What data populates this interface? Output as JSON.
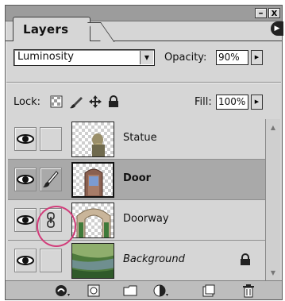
{
  "panel": {
    "tab_label": "Layers",
    "window_buttons": [
      "–",
      "x"
    ]
  },
  "blend_mode": {
    "selected": "Luminosity"
  },
  "opacity": {
    "label": "Opacity:",
    "value": "90%"
  },
  "lock": {
    "label": "Lock:",
    "icons": [
      "transparent-pixels-lock-icon",
      "brush-lock-icon",
      "move-lock-icon",
      "padlock-icon"
    ]
  },
  "fill": {
    "label": "Fill:",
    "value": "100%"
  },
  "layers": [
    {
      "name": "Statue",
      "style": "normal",
      "selected": false,
      "state_icon": ""
    },
    {
      "name": "Door",
      "style": "bold",
      "selected": true,
      "state_icon": "brush-icon"
    },
    {
      "name": "Doorway",
      "style": "normal",
      "selected": false,
      "state_icon": "mask-link-icon"
    },
    {
      "name": "Background",
      "style": "italic",
      "selected": false,
      "state_icon": "",
      "locked": true
    }
  ],
  "bottom_bar": {
    "icons": [
      "layer-style-icon",
      "add-mask-icon",
      "new-group-icon",
      "adjustment-layer-icon",
      "new-layer-icon",
      "trash-icon"
    ]
  },
  "colors": {
    "panel_bg": "#d6d6d6",
    "selected_row": "#a9a9a9",
    "highlight_ring": "#d23c7a"
  }
}
